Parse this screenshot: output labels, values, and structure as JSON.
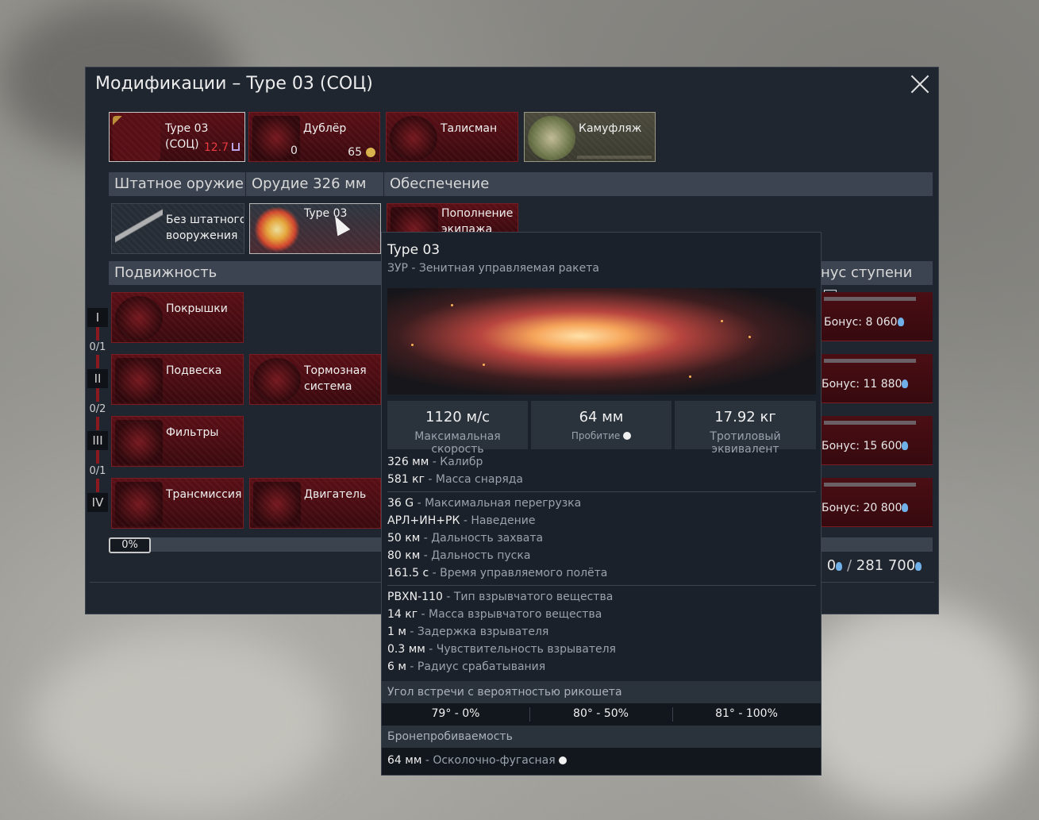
{
  "window": {
    "title": "Модификации – Type 03 (СОЦ)"
  },
  "top_slots": {
    "vehicle": {
      "label": "Type 03 (СОЦ)",
      "br": "12.7"
    },
    "crew": {
      "label": "Дублёр",
      "count": "0",
      "cost": "65"
    },
    "talisman": {
      "label": "Талисман"
    },
    "camo": {
      "label": "Камуфляж"
    }
  },
  "sections": {
    "standard_weapons": "Штатное оружие",
    "gun": "Орудие 326 мм",
    "support": "Обеспечение",
    "mobility": "Подвижность",
    "tier_bonus": "нус ступени"
  },
  "weapon_slots": {
    "no_weapons": "Без штатного вооружения",
    "type03": "Type 03",
    "crew_replenish": "Пополнение экипажа"
  },
  "mobility_slots": [
    "Покрышки",
    "Подвеска",
    "Тормозная система",
    "Фильтры",
    "Трансмиссия",
    "Двигатель"
  ],
  "tiers": [
    "I",
    "II",
    "III",
    "IV"
  ],
  "tier_counts": [
    "0/1",
    "0/2",
    "0/1"
  ],
  "bonuses": [
    "Бонус: 8 060",
    "Бонус: 11 880",
    "Бонус: 15 600",
    "Бонус: 20 800"
  ],
  "progress": {
    "percent": "0%",
    "rp_current": ": 0",
    "rp_total": "281 700"
  },
  "tooltip": {
    "name": "Type 03",
    "subtitle": "ЗУР - Зенитная управляемая ракета",
    "stats": [
      {
        "value": "1120 м/с",
        "label": "Максимальная скорость"
      },
      {
        "value": "64 мм",
        "label": "Пробитие"
      },
      {
        "value": "17.92 кг",
        "label": "Тротиловый эквивалент"
      }
    ],
    "group1": [
      {
        "v": "326 мм",
        "d": " - Калибр"
      },
      {
        "v": "581 кг",
        "d": " - Масса снаряда"
      }
    ],
    "group2": [
      {
        "v": "36 G",
        "d": " - Максимальная перегрузка"
      },
      {
        "v": "АРЛ+ИН+РК",
        "d": " - Наведение"
      },
      {
        "v": "50 км",
        "d": " - Дальность захвата"
      },
      {
        "v": "80 км",
        "d": " - Дальность пуска"
      },
      {
        "v": "161.5 с",
        "d": " - Время управляемого полёта"
      }
    ],
    "group3": [
      {
        "v": "PBXN-110",
        "d": " - Тип взрывчатого вещества"
      },
      {
        "v": "14 кг",
        "d": " - Масса взрывчатого вещества"
      },
      {
        "v": "1 м",
        "d": " - Задержка взрывателя"
      },
      {
        "v": "0.3 мм",
        "d": " - Чувствительность взрывателя"
      },
      {
        "v": "6 м",
        "d": " - Радиус срабатывания"
      }
    ],
    "ricochet_title": "Угол встречи с вероятностью рикошета",
    "ricochet": [
      "79° - 0%",
      "80° - 50%",
      "81° - 100%"
    ],
    "penetration_title": "Бронепробиваемость",
    "penetration": {
      "v": "64 мм",
      "d": " - Осколочно-фугасная"
    }
  },
  "colors": {
    "br": "#e8383d",
    "accent_red": "#7a1c22",
    "rp": "#6fb0e8"
  }
}
